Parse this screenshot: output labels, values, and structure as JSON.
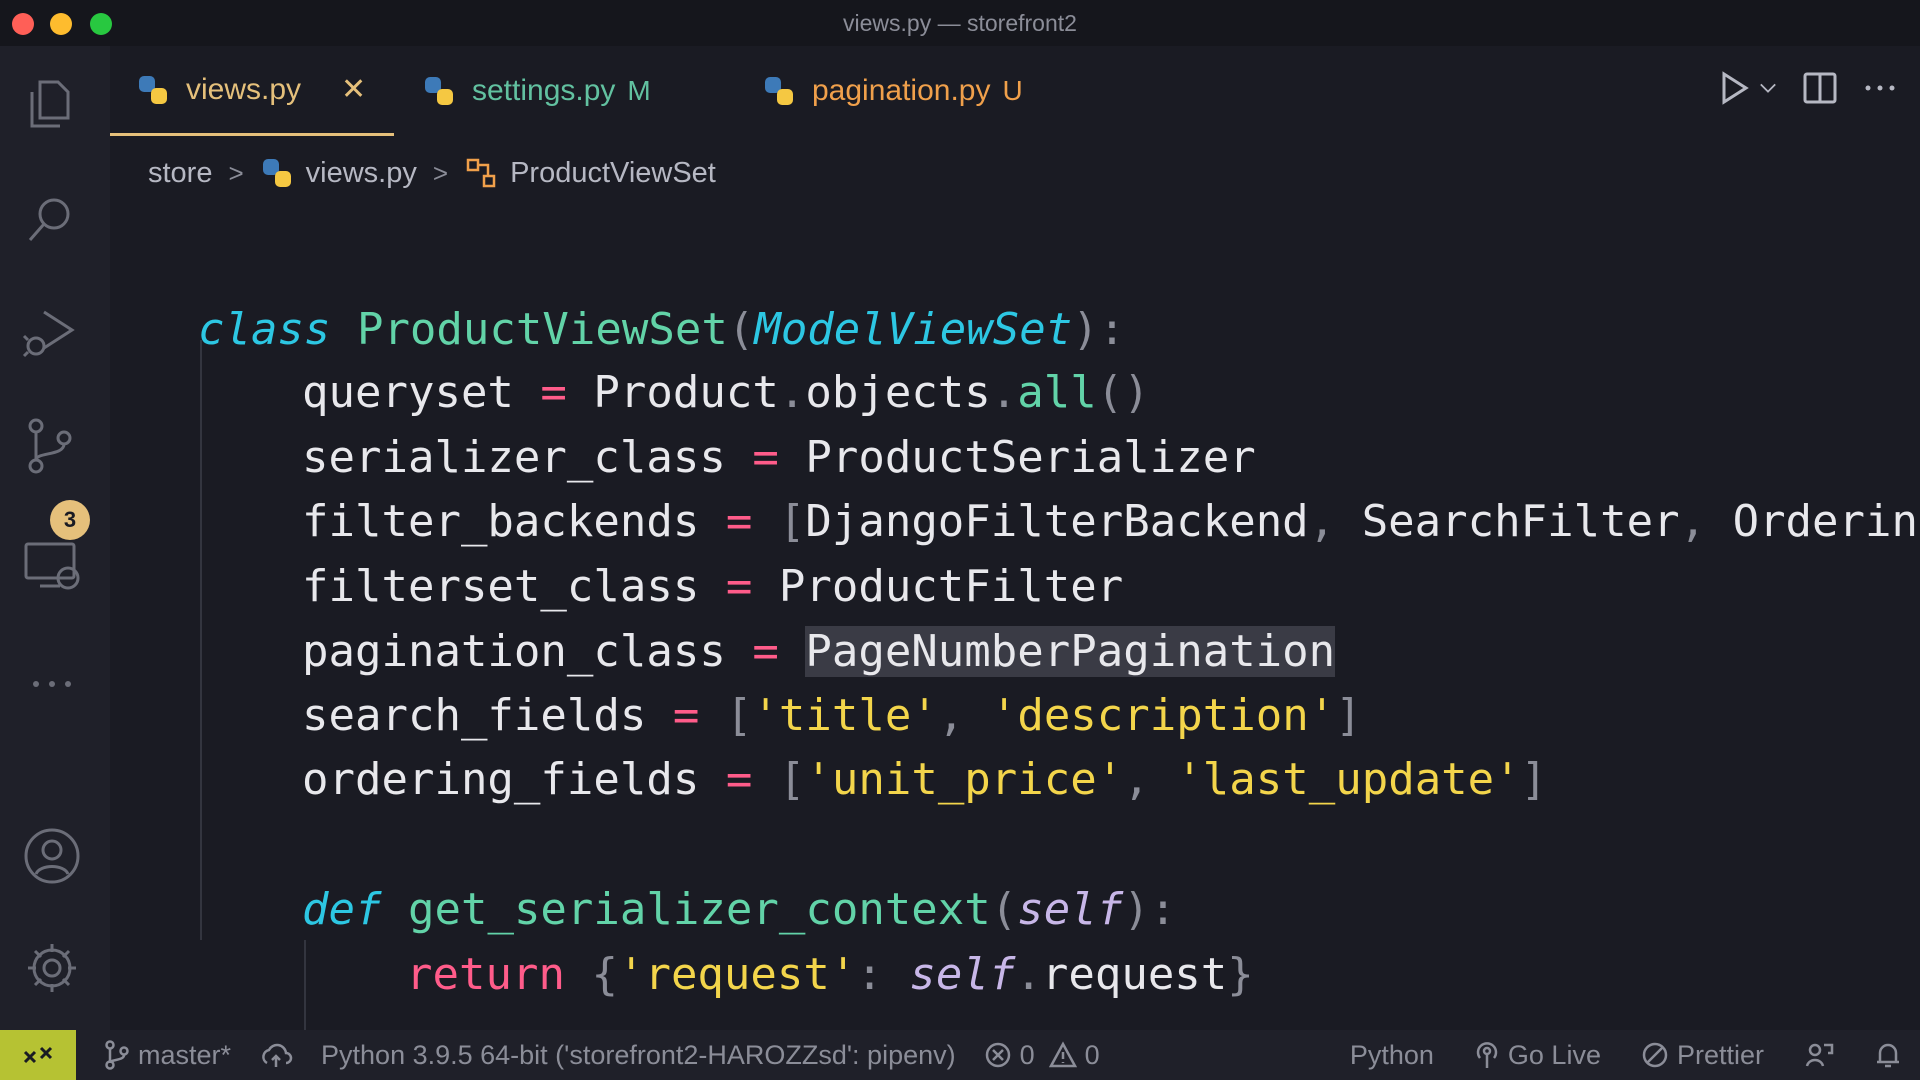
{
  "window": {
    "title": "views.py — storefront2"
  },
  "colors": {
    "red": "#ff5f57",
    "yellow": "#febc2e",
    "green": "#28c840",
    "accent": "#e5c07b"
  },
  "activity": {
    "source_control_badge": "3"
  },
  "tabs": [
    {
      "label": "views.py",
      "status": "",
      "active": true
    },
    {
      "label": "settings.py",
      "status": "M",
      "active": false
    },
    {
      "label": "pagination.py",
      "status": "U",
      "active": false
    }
  ],
  "breadcrumb": {
    "folder": "store",
    "file": "views.py",
    "symbol": "ProductViewSet"
  },
  "code": {
    "class_kw": "class",
    "class_name": "ProductViewSet",
    "base_class": "ModelViewSet",
    "queryset_var": "queryset",
    "queryset_val": "Product",
    "queryset_objects": "objects",
    "queryset_all": "all",
    "serializer_var": "serializer_class",
    "serializer_val": "ProductSerializer",
    "filter_backends_var": "filter_backends",
    "filter_backend_1": "DjangoFilterBackend",
    "filter_backend_2": "SearchFilter",
    "filter_backend_3": "OrderingFilter",
    "filterset_var": "filterset_class",
    "filterset_val": "ProductFilter",
    "pagination_var": "pagination_class",
    "pagination_val": "PageNumberPagination",
    "search_var": "search_fields",
    "search_1": "title",
    "search_2": "description",
    "ordering_var": "ordering_fields",
    "ordering_1": "unit_price",
    "ordering_2": "last_update",
    "def_kw": "def",
    "def_name": "get_serializer_context",
    "self_kw": "self",
    "return_kw": "return",
    "request_key": "request",
    "request_attr": "request"
  },
  "statusbar": {
    "branch": "master*",
    "interpreter": "Python 3.9.5 64-bit ('storefront2-HAROZZsd': pipenv)",
    "errors": "0",
    "warnings": "0",
    "language": "Python",
    "go_live": "Go Live",
    "prettier": "Prettier"
  }
}
